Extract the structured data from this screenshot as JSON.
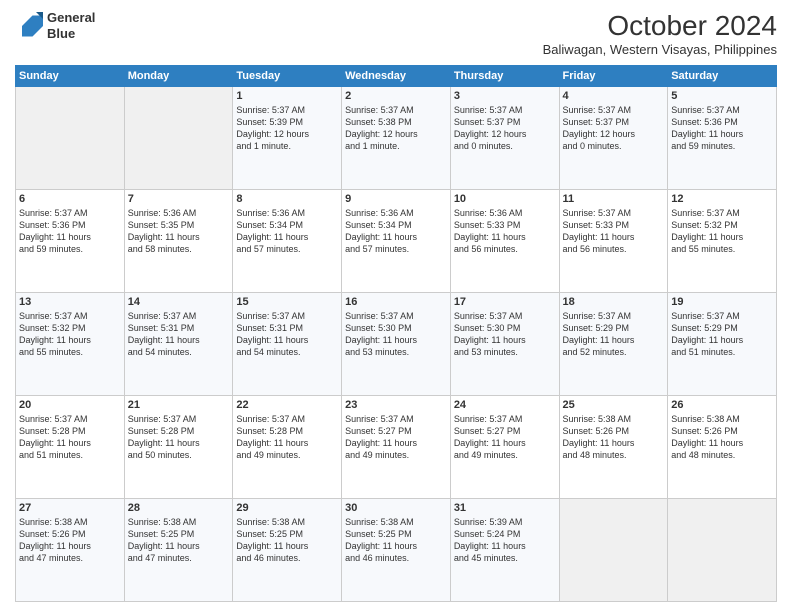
{
  "logo": {
    "line1": "General",
    "line2": "Blue"
  },
  "title": "October 2024",
  "subtitle": "Baliwagan, Western Visayas, Philippines",
  "headers": [
    "Sunday",
    "Monday",
    "Tuesday",
    "Wednesday",
    "Thursday",
    "Friday",
    "Saturday"
  ],
  "weeks": [
    [
      {
        "day": "",
        "content": ""
      },
      {
        "day": "",
        "content": ""
      },
      {
        "day": "1",
        "content": "Sunrise: 5:37 AM\nSunset: 5:39 PM\nDaylight: 12 hours\nand 1 minute."
      },
      {
        "day": "2",
        "content": "Sunrise: 5:37 AM\nSunset: 5:38 PM\nDaylight: 12 hours\nand 1 minute."
      },
      {
        "day": "3",
        "content": "Sunrise: 5:37 AM\nSunset: 5:37 PM\nDaylight: 12 hours\nand 0 minutes."
      },
      {
        "day": "4",
        "content": "Sunrise: 5:37 AM\nSunset: 5:37 PM\nDaylight: 12 hours\nand 0 minutes."
      },
      {
        "day": "5",
        "content": "Sunrise: 5:37 AM\nSunset: 5:36 PM\nDaylight: 11 hours\nand 59 minutes."
      }
    ],
    [
      {
        "day": "6",
        "content": "Sunrise: 5:37 AM\nSunset: 5:36 PM\nDaylight: 11 hours\nand 59 minutes."
      },
      {
        "day": "7",
        "content": "Sunrise: 5:36 AM\nSunset: 5:35 PM\nDaylight: 11 hours\nand 58 minutes."
      },
      {
        "day": "8",
        "content": "Sunrise: 5:36 AM\nSunset: 5:34 PM\nDaylight: 11 hours\nand 57 minutes."
      },
      {
        "day": "9",
        "content": "Sunrise: 5:36 AM\nSunset: 5:34 PM\nDaylight: 11 hours\nand 57 minutes."
      },
      {
        "day": "10",
        "content": "Sunrise: 5:36 AM\nSunset: 5:33 PM\nDaylight: 11 hours\nand 56 minutes."
      },
      {
        "day": "11",
        "content": "Sunrise: 5:37 AM\nSunset: 5:33 PM\nDaylight: 11 hours\nand 56 minutes."
      },
      {
        "day": "12",
        "content": "Sunrise: 5:37 AM\nSunset: 5:32 PM\nDaylight: 11 hours\nand 55 minutes."
      }
    ],
    [
      {
        "day": "13",
        "content": "Sunrise: 5:37 AM\nSunset: 5:32 PM\nDaylight: 11 hours\nand 55 minutes."
      },
      {
        "day": "14",
        "content": "Sunrise: 5:37 AM\nSunset: 5:31 PM\nDaylight: 11 hours\nand 54 minutes."
      },
      {
        "day": "15",
        "content": "Sunrise: 5:37 AM\nSunset: 5:31 PM\nDaylight: 11 hours\nand 54 minutes."
      },
      {
        "day": "16",
        "content": "Sunrise: 5:37 AM\nSunset: 5:30 PM\nDaylight: 11 hours\nand 53 minutes."
      },
      {
        "day": "17",
        "content": "Sunrise: 5:37 AM\nSunset: 5:30 PM\nDaylight: 11 hours\nand 53 minutes."
      },
      {
        "day": "18",
        "content": "Sunrise: 5:37 AM\nSunset: 5:29 PM\nDaylight: 11 hours\nand 52 minutes."
      },
      {
        "day": "19",
        "content": "Sunrise: 5:37 AM\nSunset: 5:29 PM\nDaylight: 11 hours\nand 51 minutes."
      }
    ],
    [
      {
        "day": "20",
        "content": "Sunrise: 5:37 AM\nSunset: 5:28 PM\nDaylight: 11 hours\nand 51 minutes."
      },
      {
        "day": "21",
        "content": "Sunrise: 5:37 AM\nSunset: 5:28 PM\nDaylight: 11 hours\nand 50 minutes."
      },
      {
        "day": "22",
        "content": "Sunrise: 5:37 AM\nSunset: 5:28 PM\nDaylight: 11 hours\nand 49 minutes."
      },
      {
        "day": "23",
        "content": "Sunrise: 5:37 AM\nSunset: 5:27 PM\nDaylight: 11 hours\nand 49 minutes."
      },
      {
        "day": "24",
        "content": "Sunrise: 5:37 AM\nSunset: 5:27 PM\nDaylight: 11 hours\nand 49 minutes."
      },
      {
        "day": "25",
        "content": "Sunrise: 5:38 AM\nSunset: 5:26 PM\nDaylight: 11 hours\nand 48 minutes."
      },
      {
        "day": "26",
        "content": "Sunrise: 5:38 AM\nSunset: 5:26 PM\nDaylight: 11 hours\nand 48 minutes."
      }
    ],
    [
      {
        "day": "27",
        "content": "Sunrise: 5:38 AM\nSunset: 5:26 PM\nDaylight: 11 hours\nand 47 minutes."
      },
      {
        "day": "28",
        "content": "Sunrise: 5:38 AM\nSunset: 5:25 PM\nDaylight: 11 hours\nand 47 minutes."
      },
      {
        "day": "29",
        "content": "Sunrise: 5:38 AM\nSunset: 5:25 PM\nDaylight: 11 hours\nand 46 minutes."
      },
      {
        "day": "30",
        "content": "Sunrise: 5:38 AM\nSunset: 5:25 PM\nDaylight: 11 hours\nand 46 minutes."
      },
      {
        "day": "31",
        "content": "Sunrise: 5:39 AM\nSunset: 5:24 PM\nDaylight: 11 hours\nand 45 minutes."
      },
      {
        "day": "",
        "content": ""
      },
      {
        "day": "",
        "content": ""
      }
    ]
  ]
}
